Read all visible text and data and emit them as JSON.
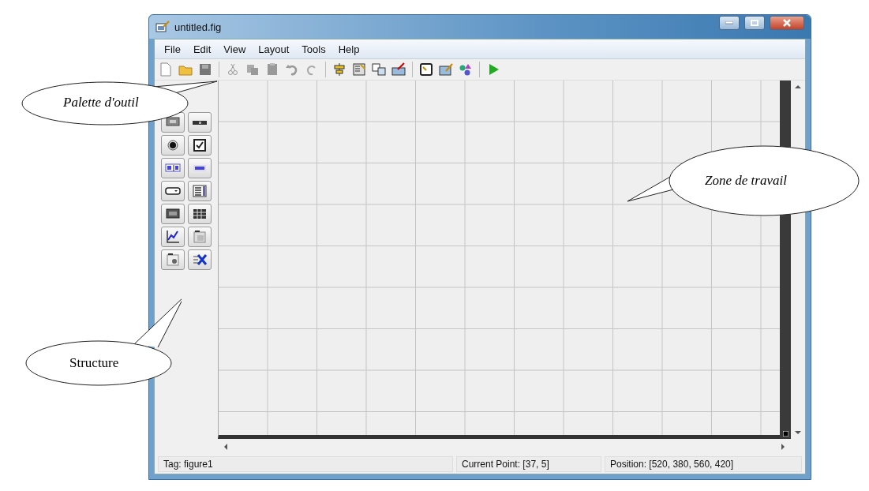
{
  "window": {
    "title": "untitled.fig"
  },
  "menu": [
    "File",
    "Edit",
    "View",
    "Layout",
    "Tools",
    "Help"
  ],
  "status_bar": {
    "tag": "Tag: figure1",
    "current_point": "Current Point:  [37, 5]",
    "position": "Position: [520, 380, 560, 420]"
  },
  "callouts": [
    {
      "text": "Palette d'outil",
      "italic": true
    },
    {
      "text": "Zone de travail",
      "italic": true
    },
    {
      "text": "Structure",
      "italic": false
    }
  ]
}
